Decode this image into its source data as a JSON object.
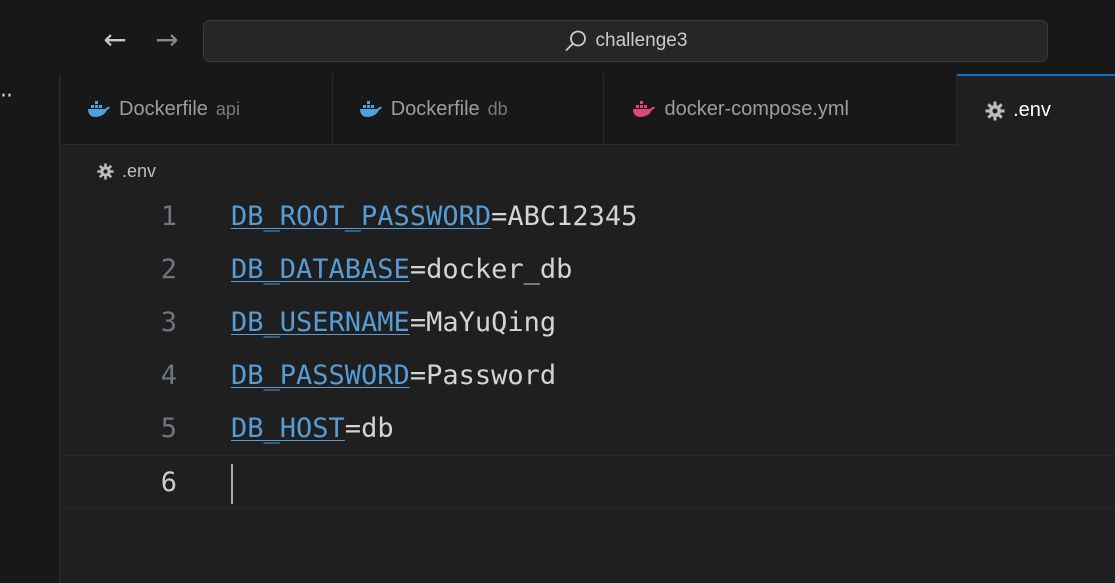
{
  "titlebar": {
    "back_glyph": "←",
    "forward_glyph": "→",
    "search_text": "challenge3"
  },
  "activity": {
    "more_glyph": "··"
  },
  "tabs": [
    {
      "label": "Dockerfile",
      "description": "api",
      "icon": "docker-icon",
      "icon_color": "#4aa3df"
    },
    {
      "label": "Dockerfile",
      "description": "db",
      "icon": "docker-icon",
      "icon_color": "#4aa3df"
    },
    {
      "label": "docker-compose.yml",
      "description": "",
      "icon": "docker-icon",
      "icon_color": "#e0457b"
    },
    {
      "label": ".env",
      "description": "",
      "icon": "gear-icon",
      "icon_color": "#bcbcbc",
      "active": true
    }
  ],
  "breadcrumb": {
    "label": ".env",
    "icon": "gear-icon"
  },
  "editor": {
    "lines": [
      {
        "number": "1",
        "key": "DB_ROOT_PASSWORD",
        "eq": "=",
        "value": "ABC12345"
      },
      {
        "number": "2",
        "key": "DB_DATABASE",
        "eq": "=",
        "value": "docker_db"
      },
      {
        "number": "3",
        "key": "DB_USERNAME",
        "eq": "=",
        "value": "MaYuQing"
      },
      {
        "number": "4",
        "key": "DB_PASSWORD",
        "eq": "=",
        "value": "Password"
      },
      {
        "number": "5",
        "key": "DB_HOST",
        "eq": "=",
        "value": "db"
      },
      {
        "number": "6",
        "key": "",
        "eq": "",
        "value": ""
      }
    ],
    "current_line": "6"
  },
  "colors": {
    "accent": "#0078d4",
    "env_key": "#569cd6",
    "background": "#1f1f1f"
  }
}
